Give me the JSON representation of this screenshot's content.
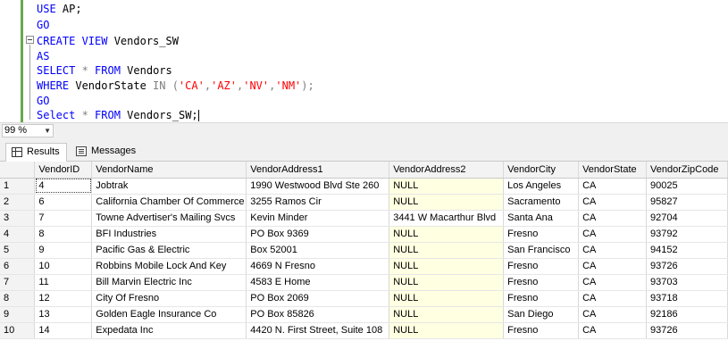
{
  "editor": {
    "lines": [
      {
        "parts": [
          {
            "t": "USE",
            "c": "kw"
          },
          {
            "t": " AP;",
            "c": ""
          }
        ]
      },
      {
        "parts": [
          {
            "t": "GO",
            "c": "kw"
          }
        ]
      },
      {
        "parts": [
          {
            "t": "CREATE VIEW",
            "c": "kw"
          },
          {
            "t": " Vendors_SW",
            "c": ""
          }
        ]
      },
      {
        "parts": [
          {
            "t": "AS",
            "c": "kw"
          }
        ]
      },
      {
        "parts": [
          {
            "t": "SELECT",
            "c": "kw"
          },
          {
            "t": " * ",
            "c": "gry"
          },
          {
            "t": "FROM",
            "c": "kw"
          },
          {
            "t": " Vendors",
            "c": ""
          }
        ]
      },
      {
        "parts": [
          {
            "t": "WHERE",
            "c": "kw"
          },
          {
            "t": " VendorState ",
            "c": ""
          },
          {
            "t": "IN",
            "c": "gry"
          },
          {
            "t": " (",
            "c": "gry"
          },
          {
            "t": "'CA'",
            "c": "str"
          },
          {
            "t": ",",
            "c": "gry"
          },
          {
            "t": "'AZ'",
            "c": "str"
          },
          {
            "t": ",",
            "c": "gry"
          },
          {
            "t": "'NV'",
            "c": "str"
          },
          {
            "t": ",",
            "c": "gry"
          },
          {
            "t": "'NM'",
            "c": "str"
          },
          {
            "t": ");",
            "c": "gry"
          }
        ]
      },
      {
        "parts": [
          {
            "t": "GO",
            "c": "kw"
          }
        ]
      },
      {
        "parts": [
          {
            "t": "Select",
            "c": "kw"
          },
          {
            "t": " * ",
            "c": "gry"
          },
          {
            "t": "FROM",
            "c": "kw"
          },
          {
            "t": " Vendors_SW;",
            "c": ""
          }
        ]
      }
    ]
  },
  "zoom": {
    "value": "99 %"
  },
  "tabs": {
    "results": "Results",
    "messages": "Messages"
  },
  "grid": {
    "columns": [
      "VendorID",
      "VendorName",
      "VendorAddress1",
      "VendorAddress2",
      "VendorCity",
      "VendorState",
      "VendorZipCode"
    ],
    "rows": [
      {
        "num": "1",
        "cells": [
          "4",
          "Jobtrak",
          "1990 Westwood Blvd Ste 260",
          "NULL",
          "Los Angeles",
          "CA",
          "90025"
        ]
      },
      {
        "num": "2",
        "cells": [
          "6",
          "California Chamber Of Commerce",
          "3255 Ramos Cir",
          "NULL",
          "Sacramento",
          "CA",
          "95827"
        ]
      },
      {
        "num": "3",
        "cells": [
          "7",
          "Towne Advertiser's Mailing Svcs",
          "Kevin Minder",
          "3441 W Macarthur Blvd",
          "Santa Ana",
          "CA",
          "92704"
        ]
      },
      {
        "num": "4",
        "cells": [
          "8",
          "BFI Industries",
          "PO Box 9369",
          "NULL",
          "Fresno",
          "CA",
          "93792"
        ]
      },
      {
        "num": "5",
        "cells": [
          "9",
          "Pacific Gas & Electric",
          "Box 52001",
          "NULL",
          "San Francisco",
          "CA",
          "94152"
        ]
      },
      {
        "num": "6",
        "cells": [
          "10",
          "Robbins Mobile Lock And Key",
          "4669 N Fresno",
          "NULL",
          "Fresno",
          "CA",
          "93726"
        ]
      },
      {
        "num": "7",
        "cells": [
          "11",
          "Bill Marvin Electric Inc",
          "4583 E Home",
          "NULL",
          "Fresno",
          "CA",
          "93703"
        ]
      },
      {
        "num": "8",
        "cells": [
          "12",
          "City Of Fresno",
          "PO Box 2069",
          "NULL",
          "Fresno",
          "CA",
          "93718"
        ]
      },
      {
        "num": "9",
        "cells": [
          "13",
          "Golden Eagle Insurance Co",
          "PO Box 85826",
          "NULL",
          "San Diego",
          "CA",
          "92186"
        ]
      },
      {
        "num": "10",
        "cells": [
          "14",
          "Expedata Inc",
          "4420 N. First Street, Suite 108",
          "NULL",
          "Fresno",
          "CA",
          "93726"
        ]
      }
    ]
  }
}
